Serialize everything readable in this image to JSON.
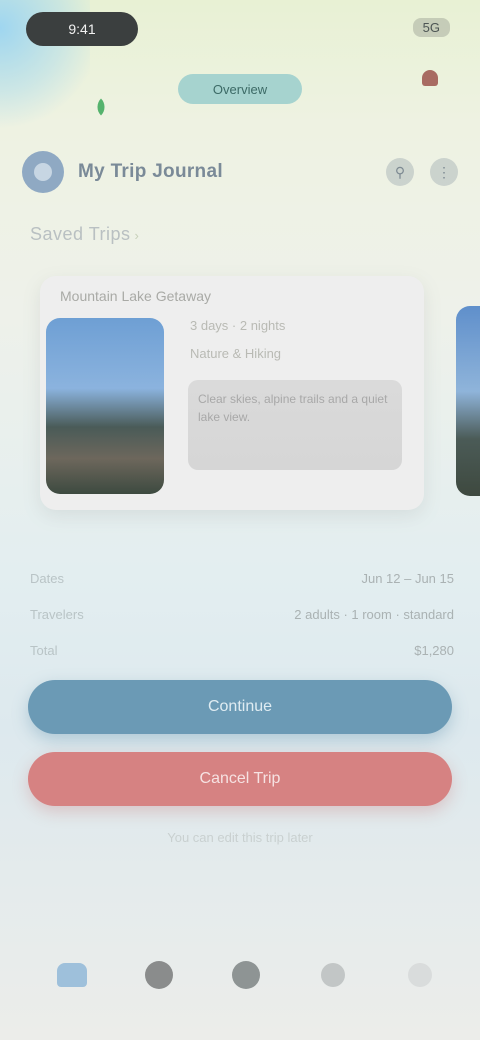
{
  "status_bar": {
    "time": "9:41",
    "right": "5G"
  },
  "top_tab": {
    "label": "Overview"
  },
  "header": {
    "title": "My Trip Journal"
  },
  "section": {
    "label": "Saved Trips"
  },
  "card": {
    "title": "Mountain Lake Getaway",
    "line1": "3 days · 2 nights",
    "line2": "Nature & Hiking",
    "description": "Clear skies, alpine trails and a quiet lake view."
  },
  "info_rows": [
    {
      "label": "Dates",
      "value": "Jun 12 – Jun 15"
    },
    {
      "label": "Travelers",
      "value": "2 adults · 1 room · standard"
    },
    {
      "label": "Total",
      "value": "$1,280"
    }
  ],
  "buttons": {
    "primary": "Continue",
    "danger": "Cancel Trip"
  },
  "footnote": "You can edit this trip later",
  "nav": {
    "home": "home-icon",
    "explore": "explore-icon",
    "add": "add-icon",
    "chat": "chat-icon",
    "profile": "profile-icon"
  },
  "colors": {
    "primary": "#6b9ab5",
    "danger": "#d68282",
    "accent_tab": "#a6d3cf"
  }
}
